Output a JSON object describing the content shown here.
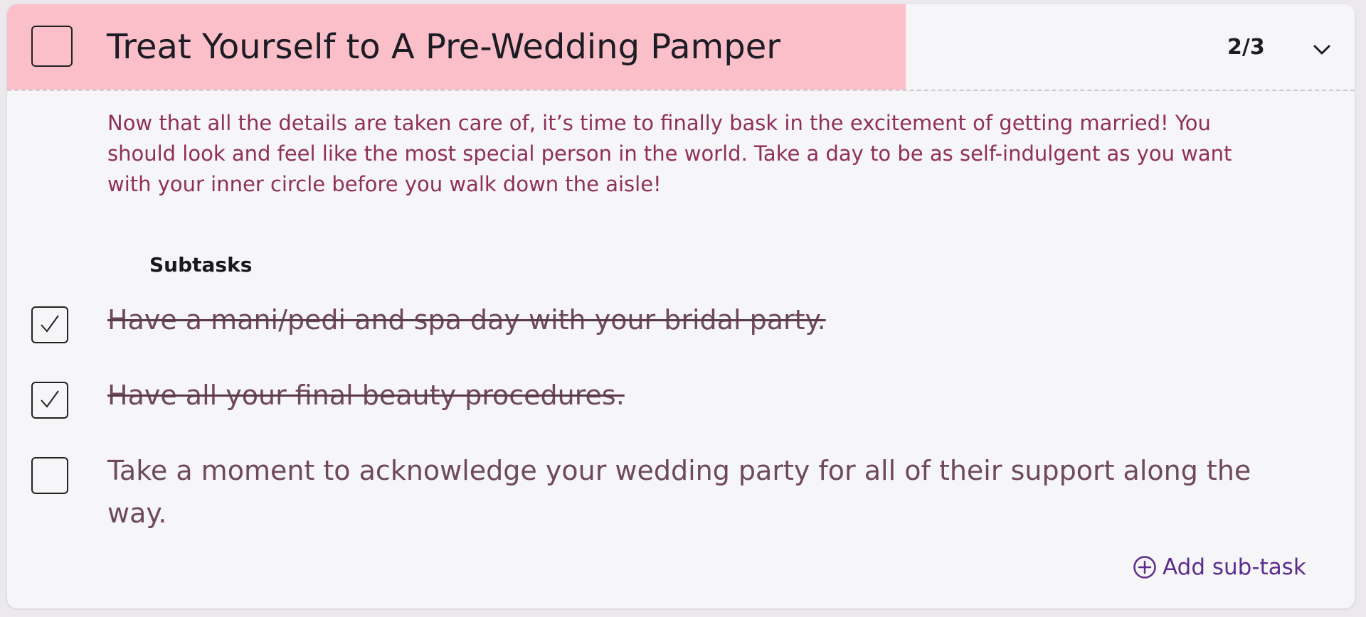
{
  "task": {
    "title": "Treat Yourself to A Pre-Wedding Pamper",
    "progress_text": "2/3",
    "progress_fraction": 0.667,
    "progress_color": "#fbbfca",
    "checked": false,
    "description": "Now that all the details are taken care of, it’s time to finally bask in the excitement of getting married! You should look and feel like the most special person in the world. Take a day to be as self-indulgent as you want with your inner circle before you walk down the aisle!"
  },
  "subtasks": {
    "heading": "Subtasks",
    "items": [
      {
        "label": "Have a mani/pedi and spa day with your bridal party.",
        "checked": true
      },
      {
        "label": "Have all your final beauty procedures.",
        "checked": true
      },
      {
        "label": "Take a moment to acknowledge your wedding party for all of their support along the way.",
        "checked": false
      }
    ],
    "add_label": "Add sub-task"
  },
  "icons": {
    "expand": "chevron-down-icon",
    "add": "plus-circle-icon",
    "check": "checkmark-icon"
  },
  "colors": {
    "accent": "#5b2d8e",
    "description_text": "#8f2f5a"
  }
}
